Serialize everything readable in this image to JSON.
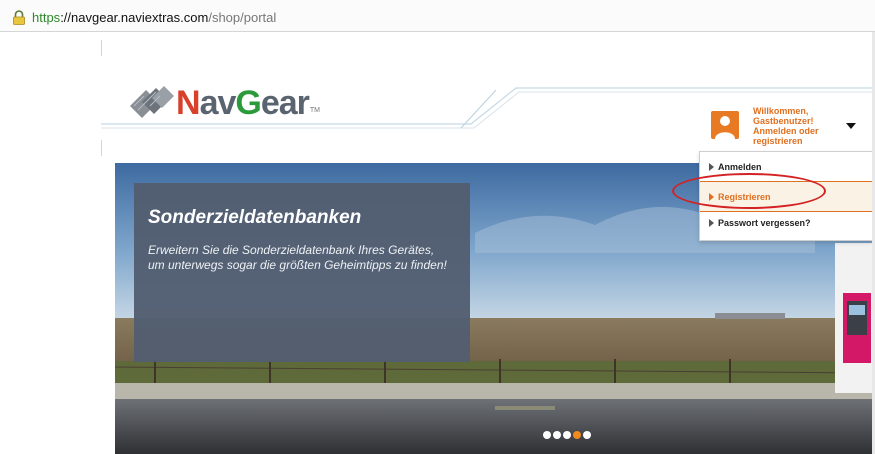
{
  "browser": {
    "url_scheme": "https",
    "url_sep": "://",
    "url_host": "navgear.naviextras.com",
    "url_path": "/shop/portal"
  },
  "logo": {
    "part_n": "N",
    "part_av": "av",
    "part_g": "G",
    "part_ear": "ear",
    "tm": "TM"
  },
  "user_menu": {
    "welcome_line1": "Willkommen,",
    "welcome_line2": "Gastbenutzer!",
    "welcome_line3": "Anmelden oder",
    "welcome_line4": "registrieren",
    "items": [
      {
        "label": "Anmelden"
      },
      {
        "label": "Registrieren"
      },
      {
        "label": "Passwort vergessen?"
      }
    ]
  },
  "hero": {
    "title": "Sonderzieldatenbanken",
    "text": "Erweitern Sie die Sonderzieldatenbank Ihres Gerätes, um unterwegs sogar die größten Geheimtipps zu finden!",
    "slides_total": 5,
    "active_slide": 4
  },
  "colors": {
    "accent": "#e07020",
    "highlight_ring": "#d42222",
    "panel": "#525e70"
  }
}
